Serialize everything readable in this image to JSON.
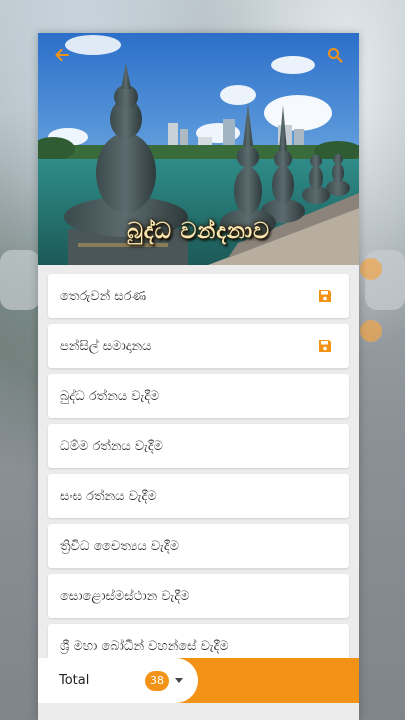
{
  "header": {
    "title": "බුද්ධ වන්දනාව",
    "back_icon": "back-arrow-icon",
    "search_icon": "search-icon"
  },
  "list": {
    "items": [
      {
        "label": "තෙරුවන් සරණ",
        "saved": true
      },
      {
        "label": "පන්සිල් සමාදානය",
        "saved": true
      },
      {
        "label": "බුද්ධ රත්නය වැදීම",
        "saved": false
      },
      {
        "label": "ධම්ම රත්නය වැදීම",
        "saved": false
      },
      {
        "label": "සංඝ රත්නය වැදීම",
        "saved": false
      },
      {
        "label": "ත්‍රිවිධ චෛත්‍යය වැදීම",
        "saved": false
      },
      {
        "label": "සොළොස්මස්ථාන වැදීම",
        "saved": false
      },
      {
        "label": "ශ්‍රී මහා බෝධීන් වහන්සේ වැදීම",
        "saved": false
      }
    ]
  },
  "footer": {
    "total_label": "Total",
    "total_count": "38"
  },
  "colors": {
    "accent": "#f29318",
    "card_bg": "#ececec"
  }
}
